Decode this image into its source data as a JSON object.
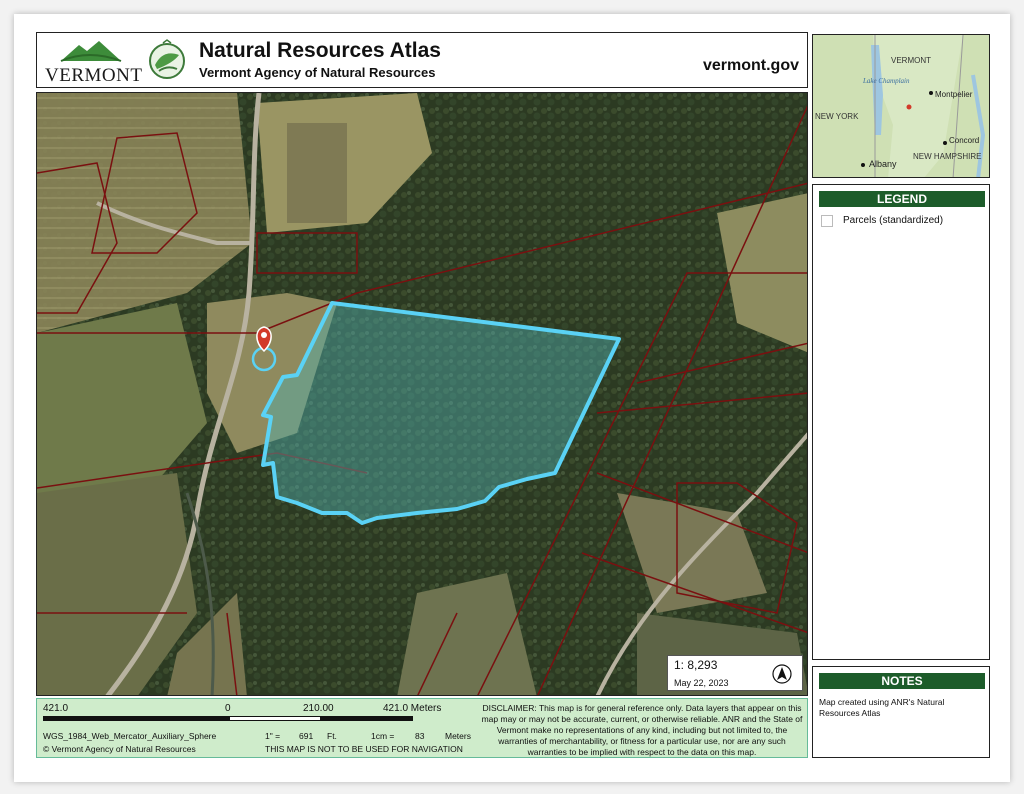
{
  "header": {
    "logo_text": "VERMONT",
    "title": "Natural Resources Atlas",
    "subtitle": "Vermont Agency of Natural Resources",
    "website": "vermont.gov"
  },
  "inset_map": {
    "labels": [
      "VERMONT",
      "Lake Champlain",
      "Montpelier",
      "NEW YORK",
      "Concord",
      "NEW HAMPSHIRE",
      "Albany"
    ]
  },
  "legend": {
    "title": "LEGEND",
    "items": [
      {
        "label": "Parcels (standardized)"
      }
    ]
  },
  "notes": {
    "title": "NOTES",
    "text": "Map created using ANR's Natural Resources Atlas"
  },
  "map": {
    "scale_ratio": "1:  8,293",
    "date": "May 22, 2023",
    "colors": {
      "parcel_line": "#7a1010",
      "highlight": "#5ad2f5",
      "pin": "#d23a2a"
    }
  },
  "footer": {
    "scale_left": "421.0",
    "scale_zero": "0",
    "scale_mid": "210.00",
    "scale_right": "421.0 Meters",
    "projection": "WGS_1984_Web_Mercator_Auxiliary_Sphere",
    "inch_label": "1\" =",
    "inch_value": "691",
    "inch_unit": "Ft.",
    "cm_label": "1cm =",
    "cm_value": "83",
    "cm_unit": "Meters",
    "copyright": "© Vermont Agency of Natural Resources",
    "nav_warning": "THIS MAP IS NOT TO BE USED FOR NAVIGATION",
    "disclaimer": "DISCLAIMER: This map is for general reference only. Data layers that appear on this map may or may not be accurate, current, or otherwise reliable. ANR and the State of Vermont make no representations of any kind, including but not limited to, the warranties of merchantability, or fitness for a particular use, nor are any such warranties to be implied with respect to the data on this map."
  }
}
